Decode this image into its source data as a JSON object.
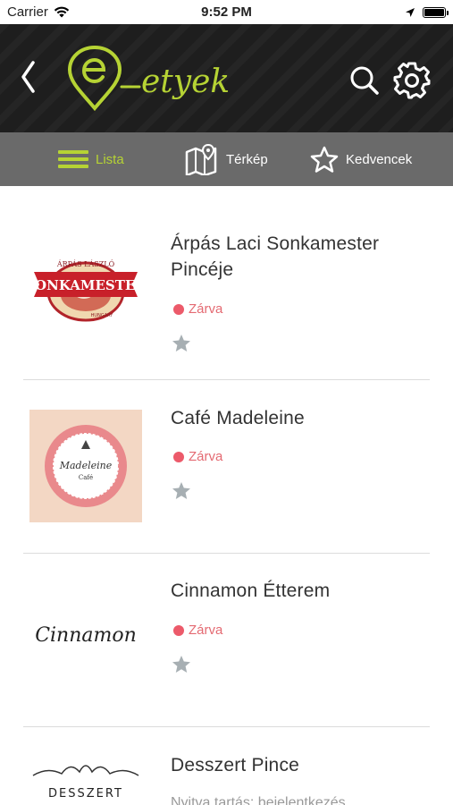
{
  "status_bar": {
    "carrier": "Carrier",
    "time": "9:52 PM"
  },
  "header": {
    "logo_text": "etyek",
    "icons": [
      "back-chevron-icon",
      "search-icon",
      "gear-icon"
    ]
  },
  "tabs": [
    {
      "label": "Lista",
      "icon": "menu-lines-icon",
      "active": true
    },
    {
      "label": "Térkép",
      "icon": "map-icon",
      "active": false
    },
    {
      "label": "Kedvencek",
      "icon": "star-outline-icon",
      "active": false
    }
  ],
  "colors": {
    "accent": "#b6d334",
    "header_bg": "#1e1e1e",
    "tab_bar_bg": "#6a6a6a",
    "closed": "#ec5a6a",
    "star": "#a7afb3"
  },
  "items": [
    {
      "title": "Árpás Laci Sonkamester Pincéje",
      "status": "Zárva",
      "logo_text": "SONKAMESTER",
      "logo_top": "ÁRPÁS LÁSZLÓ",
      "logo_bottom": "HUNGARY"
    },
    {
      "title": "Café Madeleine",
      "status": "Zárva",
      "logo_text": "Madeleine",
      "logo_sub": "Café"
    },
    {
      "title": "Cinnamon Étterem",
      "status": "Zárva",
      "logo_text": "Cinnamon"
    },
    {
      "title": "Desszert Pince",
      "note": "Nyitva tartás: bejelentkezés",
      "logo_text": "DESSZERT"
    }
  ]
}
